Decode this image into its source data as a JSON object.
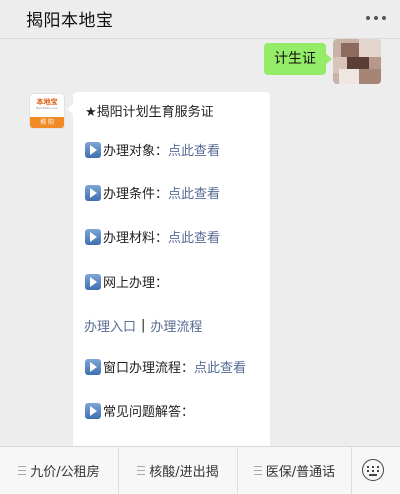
{
  "header": {
    "title": "揭阳本地宝",
    "more_icon": "more-dots-icon"
  },
  "sent": {
    "text": "计生证"
  },
  "bot": {
    "avatar": {
      "brand": "本地宝",
      "url": "Bendibao.com",
      "city": "揭 阳"
    }
  },
  "message": {
    "heading": "★揭阳计划生育服务证",
    "items": [
      {
        "label": "办理对象：",
        "link": "点此查看"
      },
      {
        "label": "办理条件：",
        "link": "点此查看"
      },
      {
        "label": "办理材料：",
        "link": "点此查看"
      },
      {
        "label": "网上办理：",
        "link": ""
      }
    ],
    "online_links": {
      "entry": "办理入口",
      "separator": "|",
      "flow": "办理流程"
    },
    "window": {
      "label": "窗口办理流程：",
      "link": "点此查看"
    },
    "faq": {
      "label": "常见问题解答："
    }
  },
  "menu": {
    "items": [
      "九价/公租房",
      "核酸/进出揭",
      "医保/普通话"
    ],
    "keyboard_icon": "keyboard-icon"
  },
  "colors": {
    "link": "#576b95",
    "sent_bubble": "#95ec69",
    "background": "#ededed"
  }
}
